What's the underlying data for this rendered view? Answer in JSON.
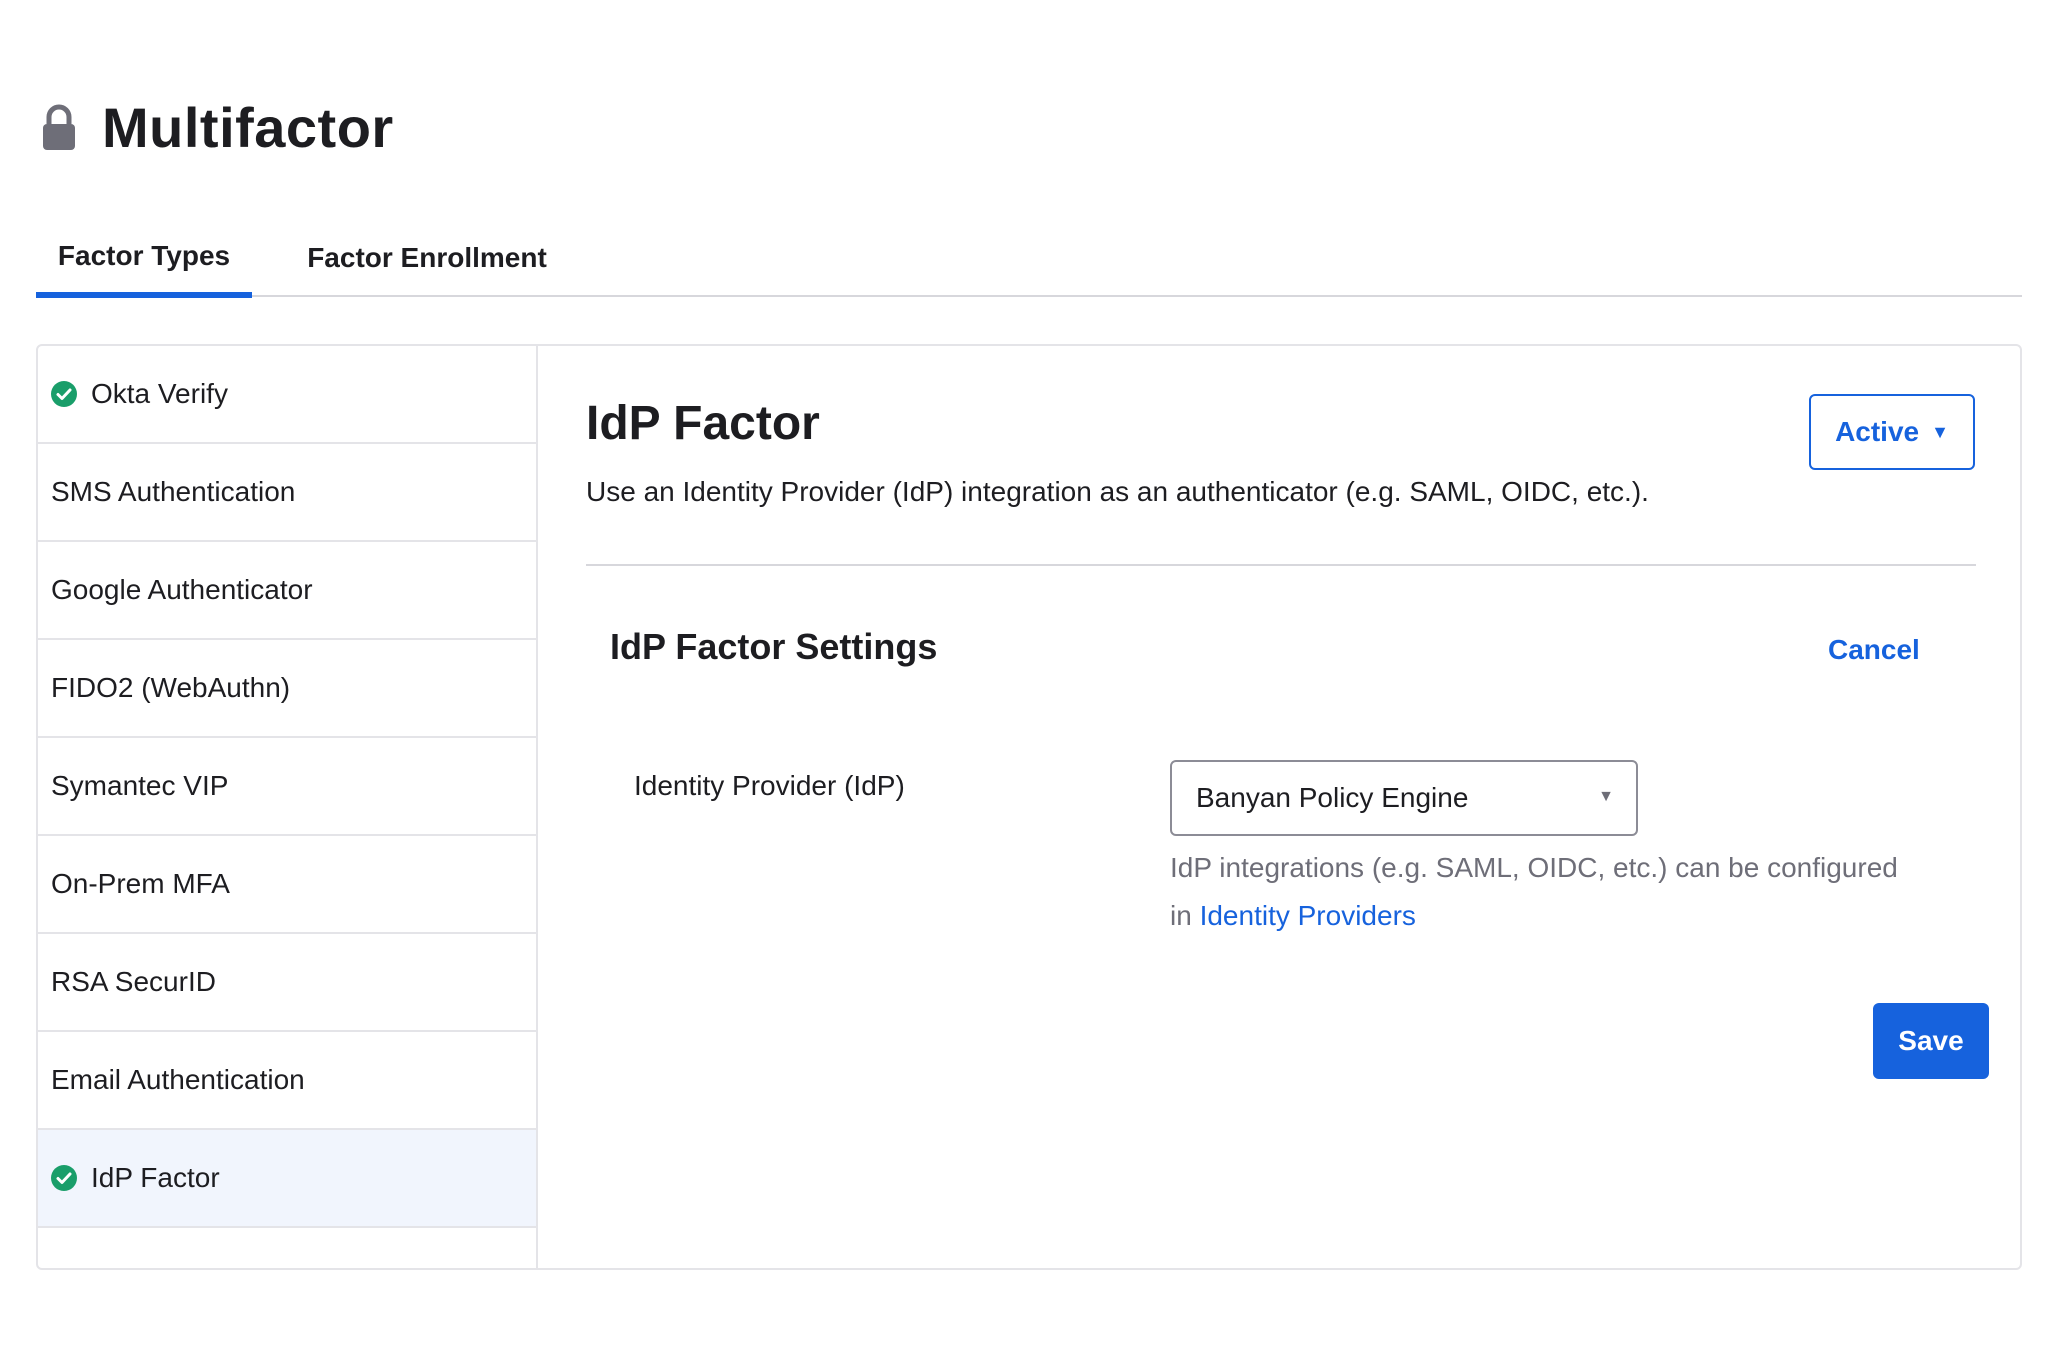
{
  "page": {
    "title": "Multifactor",
    "icon": "lock-icon"
  },
  "tabs": [
    {
      "label": "Factor Types",
      "active": true
    },
    {
      "label": "Factor Enrollment",
      "active": false
    }
  ],
  "sidebar": {
    "items": [
      {
        "label": "Okta Verify",
        "active": true,
        "selected": false
      },
      {
        "label": "SMS Authentication",
        "active": false,
        "selected": false
      },
      {
        "label": "Google Authenticator",
        "active": false,
        "selected": false
      },
      {
        "label": "FIDO2 (WebAuthn)",
        "active": false,
        "selected": false
      },
      {
        "label": "Symantec VIP",
        "active": false,
        "selected": false
      },
      {
        "label": "On-Prem MFA",
        "active": false,
        "selected": false
      },
      {
        "label": "RSA SecurID",
        "active": false,
        "selected": false
      },
      {
        "label": "Email Authentication",
        "active": false,
        "selected": false
      },
      {
        "label": "IdP Factor",
        "active": true,
        "selected": true
      }
    ]
  },
  "factor": {
    "title": "IdP Factor",
    "description": "Use an Identity Provider (IdP) integration as an authenticator (e.g. SAML, OIDC, etc.).",
    "status_label": "Active",
    "status_icon": "caret-down-icon"
  },
  "settings": {
    "title": "IdP Factor Settings",
    "cancel_label": "Cancel",
    "idp_label": "Identity Provider (IdP)",
    "idp_value": "Banyan Policy Engine",
    "help_text": "IdP integrations (e.g. SAML, OIDC, etc.) can be configured",
    "help_prefix": "in",
    "help_link": "Identity Providers",
    "save_label": "Save"
  },
  "colors": {
    "accent": "#1662dd",
    "success": "#1a9e6a",
    "selected_bg": "#f1f5fd",
    "border": "#e4e4e8"
  }
}
